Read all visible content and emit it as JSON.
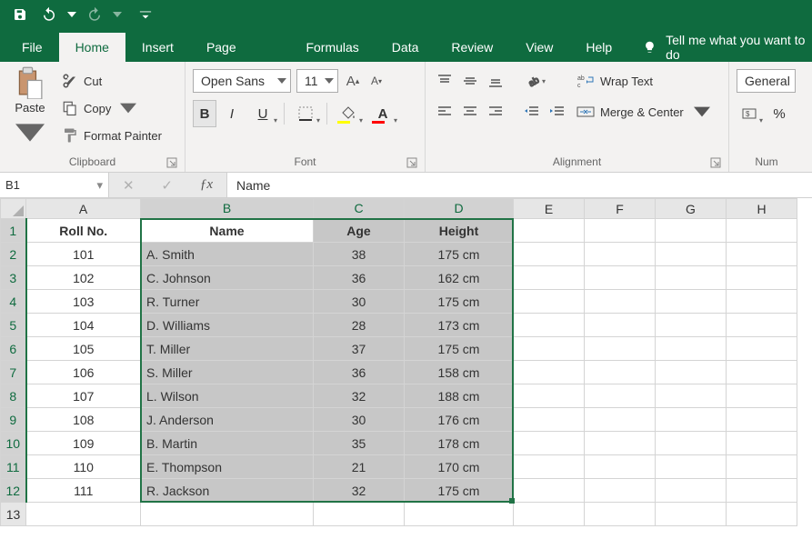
{
  "qat": {
    "save": "Save",
    "undo": "Undo",
    "redo": "Redo",
    "customize": "Customize"
  },
  "tabs": {
    "file": "File",
    "home": "Home",
    "insert": "Insert",
    "page_layout": "Page Layout",
    "formulas": "Formulas",
    "data": "Data",
    "review": "Review",
    "view": "View",
    "help": "Help",
    "tell_me": "Tell me what you want to do"
  },
  "ribbon": {
    "clipboard": {
      "label": "Clipboard",
      "paste": "Paste",
      "cut": "Cut",
      "copy": "Copy",
      "format_painter": "Format Painter"
    },
    "font": {
      "label": "Font",
      "name": "Open Sans",
      "size": "11",
      "increase": "A",
      "decrease": "A",
      "bold": "B",
      "italic": "I",
      "underline": "U",
      "fill_color": "#ffff00",
      "font_color": "#ff0000"
    },
    "alignment": {
      "label": "Alignment",
      "wrap": "Wrap Text",
      "merge": "Merge & Center"
    },
    "number": {
      "label": "Num",
      "format": "General",
      "percent": "%"
    }
  },
  "formula_bar": {
    "cell_ref": "B1",
    "formula": "Name"
  },
  "chart_data": {
    "type": "table",
    "columns": [
      "Roll No.",
      "Name",
      "Age",
      "Height"
    ],
    "rows": [
      {
        "roll": 101,
        "name": "A. Smith",
        "age": 38,
        "height": "175 cm"
      },
      {
        "roll": 102,
        "name": "C. Johnson",
        "age": 36,
        "height": "162 cm"
      },
      {
        "roll": 103,
        "name": "R. Turner",
        "age": 30,
        "height": "175 cm"
      },
      {
        "roll": 104,
        "name": "D. Williams",
        "age": 28,
        "height": "173 cm"
      },
      {
        "roll": 105,
        "name": "T. Miller",
        "age": 37,
        "height": "175 cm"
      },
      {
        "roll": 106,
        "name": "S. Miller",
        "age": 36,
        "height": "158 cm"
      },
      {
        "roll": 107,
        "name": "L. Wilson",
        "age": 32,
        "height": "188 cm"
      },
      {
        "roll": 108,
        "name": "J. Anderson",
        "age": 30,
        "height": "176 cm"
      },
      {
        "roll": 109,
        "name": "B. Martin",
        "age": 35,
        "height": "178 cm"
      },
      {
        "roll": 110,
        "name": "E. Thompson",
        "age": 21,
        "height": "170 cm"
      },
      {
        "roll": 111,
        "name": "R. Jackson",
        "age": 32,
        "height": "175 cm"
      }
    ]
  },
  "cols": [
    "A",
    "B",
    "C",
    "D",
    "E",
    "F",
    "G",
    "H"
  ],
  "col_widths": {
    "A": 126,
    "B": 190,
    "C": 100,
    "D": 120,
    "E": 78,
    "F": 78,
    "G": 78,
    "H": 78
  },
  "selection": {
    "ref": "B1:D12",
    "col_start": "B",
    "col_end": "D",
    "row_start": 1,
    "row_end": 12,
    "active": "B1"
  }
}
